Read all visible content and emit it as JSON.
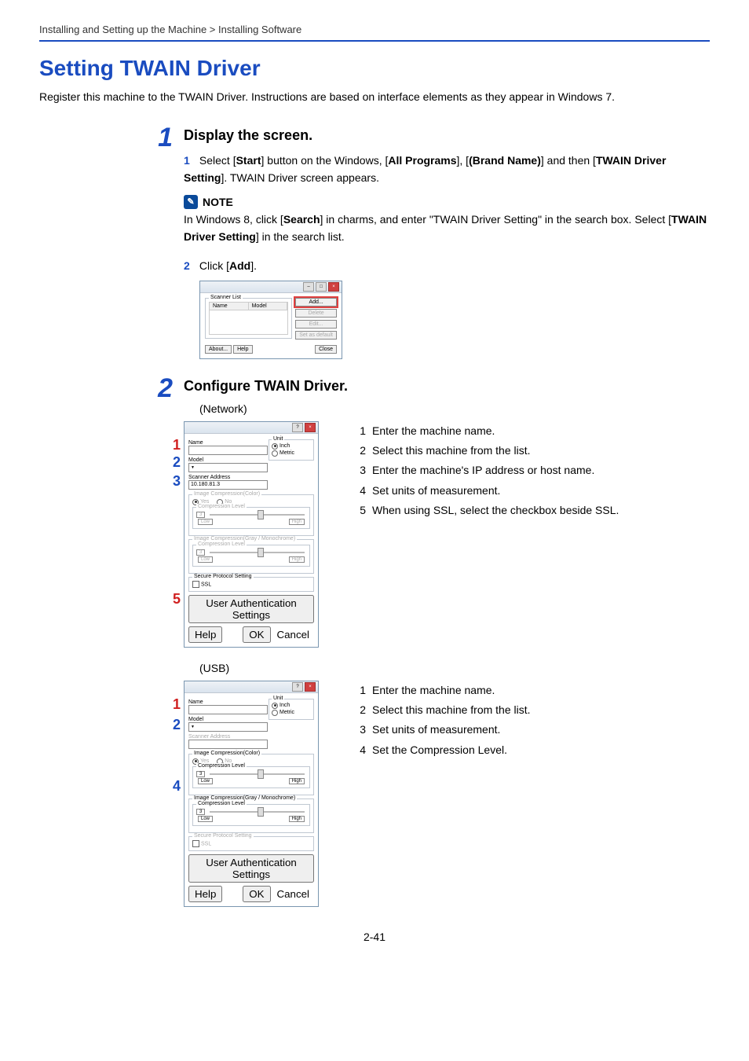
{
  "breadcrumb": "Installing and Setting up the Machine > Installing Software",
  "title": "Setting TWAIN Driver",
  "intro": "Register this machine to the TWAIN Driver. Instructions are based on interface elements as they appear in Windows 7.",
  "step1": {
    "num": "1",
    "heading": "Display the screen.",
    "sub1num": "1",
    "sub1_pre": "Select [",
    "sub1_b1": "Start",
    "sub1_mid1": "] button on the Windows, [",
    "sub1_b2": "All Programs",
    "sub1_mid2": "], [",
    "sub1_b3": "(Brand Name)",
    "sub1_mid3": "] and then [",
    "sub1_b4": "TWAIN Driver Setting",
    "sub1_post": "]. TWAIN Driver screen appears.",
    "note_label": "NOTE",
    "note_pre": "In Windows 8, click [",
    "note_b1": "Search",
    "note_mid1": "] in charms, and enter \"TWAIN Driver Setting\" in the search box. Select [",
    "note_b2": "TWAIN Driver Setting",
    "note_post": "] in the search list.",
    "sub2num": "2",
    "sub2_pre": "Click [",
    "sub2_b1": "Add",
    "sub2_post": "].",
    "dialog": {
      "scanner_list": "Scanner List",
      "col_name": "Name",
      "col_model": "Model",
      "btn_add": "Add...",
      "btn_delete": "Delete",
      "btn_edit": "Edit...",
      "btn_setdefault": "Set as default",
      "btn_about": "About...",
      "btn_help": "Help",
      "btn_close": "Close"
    }
  },
  "step2": {
    "num": "2",
    "heading": "Configure TWAIN Driver.",
    "caption_net": "(Network)",
    "caption_usb": "(USB)",
    "dialog": {
      "name": "Name",
      "model": "Model",
      "scanner_addr": "Scanner Address",
      "addr_value": "10.180.81.3",
      "unit": "Unit",
      "inch": "Inch",
      "metric": "Metric",
      "img_comp_color": "Image Compression(Color)",
      "img_comp_gray": "Image Compression(Gray / Monochrome)",
      "comp_level": "Compression Level",
      "comp_val": "3",
      "low": "Low",
      "high": "High",
      "yes": "Yes",
      "no": "No",
      "secure_proto": "Secure Protocol Setting",
      "ssl": "SSL",
      "user_auth": "User Authentication Settings",
      "help": "Help",
      "ok": "OK",
      "cancel": "Cancel"
    },
    "callouts_net": {
      "1": {
        "n": "1",
        "t": "Enter the machine name."
      },
      "2": {
        "n": "2",
        "t": "Select this machine from the list."
      },
      "3": {
        "n": "3",
        "t": "Enter the machine's IP address or host name."
      },
      "4": {
        "n": "4",
        "t": "Set units of measurement."
      },
      "5": {
        "n": "5",
        "t": "When using SSL, select the checkbox beside SSL."
      }
    },
    "callouts_usb": {
      "1": {
        "n": "1",
        "t": "Enter the machine name."
      },
      "2": {
        "n": "2",
        "t": "Select this machine from the list."
      },
      "3": {
        "n": "3",
        "t": "Set units of measurement."
      },
      "4": {
        "n": "4",
        "t": "Set the Compression Level."
      }
    }
  },
  "page_num": "2-41"
}
